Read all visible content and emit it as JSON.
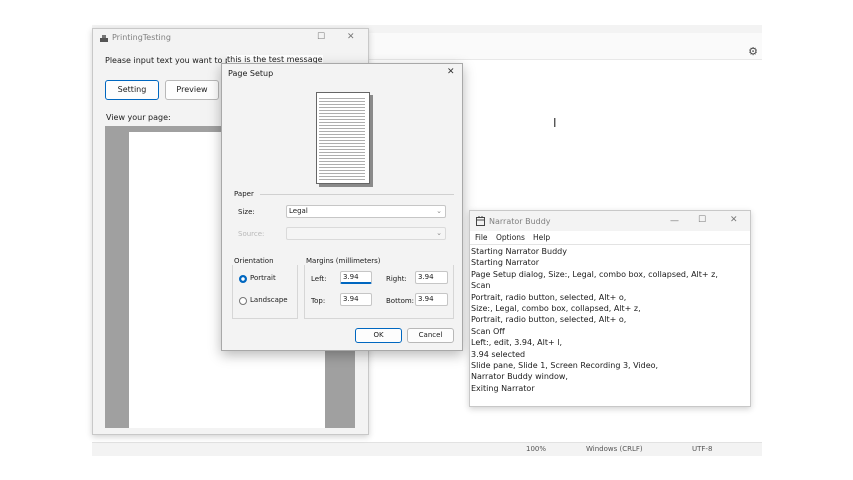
{
  "editor": {
    "status": {
      "zoom": "100%",
      "line_ending": "Windows (CRLF)",
      "encoding": "UTF-8"
    }
  },
  "printing_testing": {
    "title": "PrintingTesting",
    "prompt": "Please input text you want to print:",
    "input_value": "this is the test message",
    "setting_button": "Setting",
    "preview_button": "Preview",
    "view_label": "View your page:"
  },
  "page_setup": {
    "title": "Page Setup",
    "paper_group": "Paper",
    "size_label": "Size:",
    "size_value": "Legal",
    "source_label": "Source:",
    "orientation_group": "Orientation",
    "portrait_label": "Portrait",
    "landscape_label": "Landscape",
    "margins_group": "Margins (millimeters)",
    "left_label": "Left:",
    "left_value": "3.94",
    "right_label": "Right:",
    "right_value": "3.94",
    "top_label": "Top:",
    "top_value": "3.94",
    "bottom_label": "Bottom:",
    "bottom_value": "3.94",
    "ok_button": "OK",
    "cancel_button": "Cancel"
  },
  "narrator_buddy": {
    "title": "Narrator Buddy",
    "menu": [
      "File",
      "Options",
      "Help"
    ],
    "log": [
      "Starting Narrator Buddy",
      "Starting Narrator",
      "Page Setup dialog, Size:, Legal, combo box, collapsed, Alt+ z,",
      "Scan",
      "Portrait, radio button, selected, Alt+ o,",
      "Size:, Legal, combo box, collapsed, Alt+ z,",
      "Portrait, radio button, selected, Alt+ o,",
      "Scan Off",
      "Left:, edit, 3.94, Alt+ l,",
      "3.94 selected",
      "Slide pane, Slide 1, Screen Recording 3, Video,",
      "Narrator Buddy window,",
      "Exiting Narrator"
    ]
  },
  "colors": {
    "accent": "#0067c0",
    "dialog_bg": "#f3f3f3",
    "preview_gray": "#a0a0a0"
  }
}
